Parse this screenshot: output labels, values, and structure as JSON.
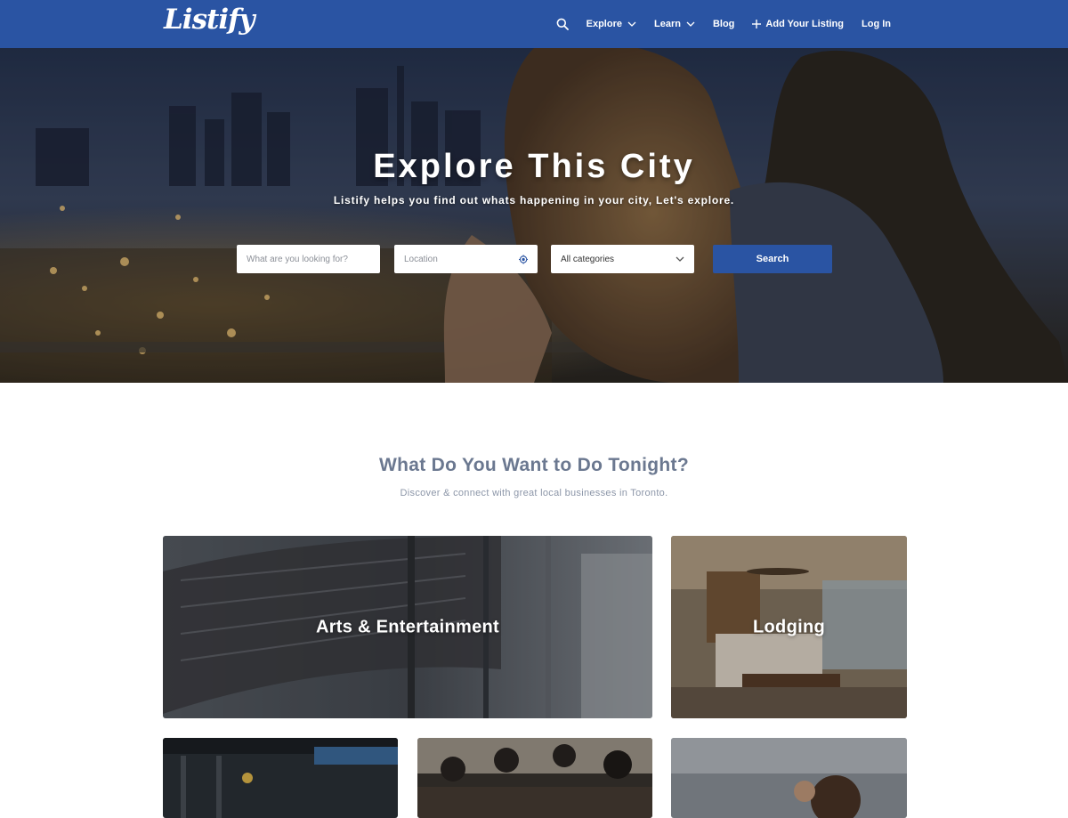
{
  "brand": {
    "logo_text": "Listify",
    "primary_color": "#2a54a3"
  },
  "nav": {
    "search_icon": "search-icon",
    "items": [
      {
        "label": "Explore",
        "has_dropdown": true
      },
      {
        "label": "Learn",
        "has_dropdown": true
      },
      {
        "label": "Blog",
        "has_dropdown": false
      },
      {
        "label": "Add Your Listing",
        "icon": "plus-icon"
      },
      {
        "label": "Log In",
        "has_dropdown": false
      }
    ]
  },
  "hero": {
    "title": "Explore This City",
    "subtitle": "Listify helps you find out whats happening in your city, Let's explore.",
    "search": {
      "keyword_placeholder": "What are you looking for?",
      "location_placeholder": "Location",
      "location_icon": "locate-icon",
      "category_selected": "All categories",
      "button_label": "Search"
    }
  },
  "section": {
    "title": "What Do You Want to Do Tonight?",
    "subtitle": "Discover & connect with great local businesses in Toronto."
  },
  "categories": [
    {
      "label": "Arts & Entertainment"
    },
    {
      "label": "Lodging"
    },
    {
      "label": ""
    },
    {
      "label": ""
    },
    {
      "label": ""
    }
  ]
}
